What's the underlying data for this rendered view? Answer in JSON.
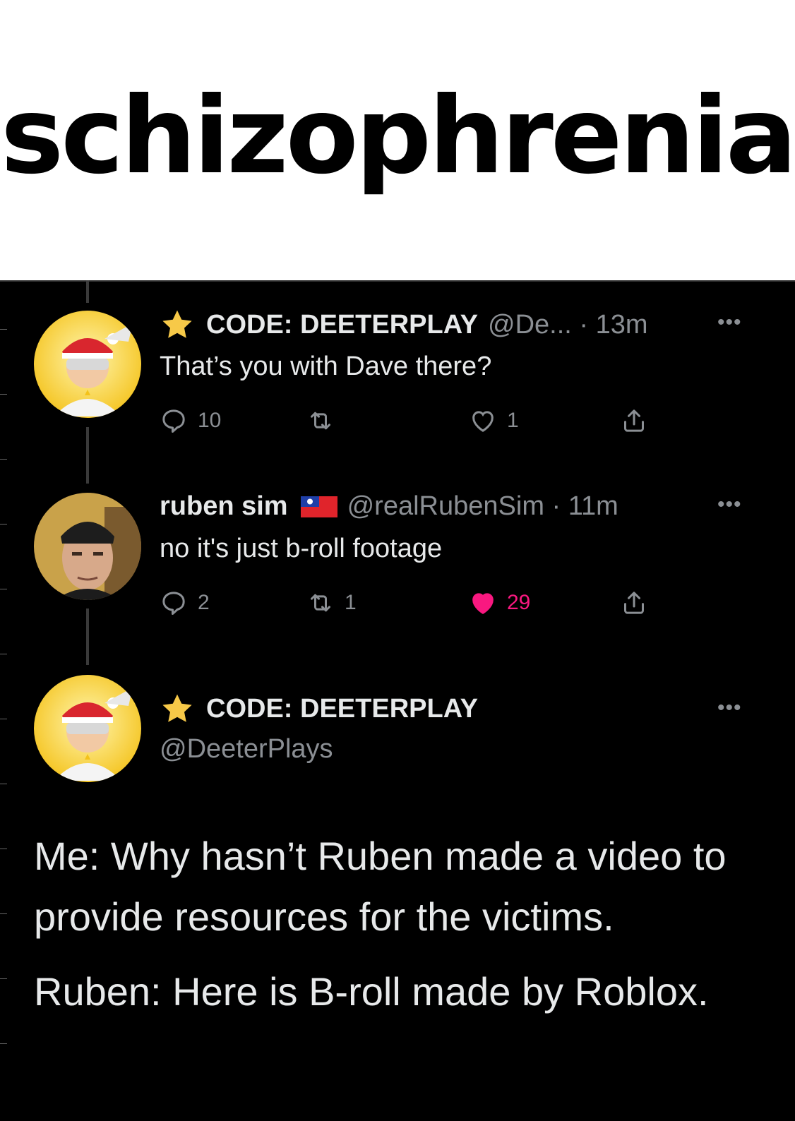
{
  "caption": {
    "text": "schizophrenia"
  },
  "tweets": [
    {
      "display_name": "CODE: DEETERPLAY",
      "handle_time": "@De... · 13m",
      "text": "That’s you with Dave there?",
      "actions": {
        "replies": "10",
        "retweets": "",
        "likes": "1"
      }
    },
    {
      "display_name": "ruben sim",
      "handle_time": "@realRubenSim · 11m",
      "text": "no it's just b-roll footage",
      "actions": {
        "replies": "2",
        "retweets": "1",
        "likes": "29",
        "liked": true
      }
    }
  ],
  "main_tweet": {
    "display_name": "CODE: DEETERPLAY",
    "handle": "@DeeterPlays",
    "paragraph_1": "Me: Why hasn’t Ruben made a video to provide resources for the victims.",
    "paragraph_2": "Ruben: Here is B-roll made by Roblox."
  },
  "colors": {
    "background": "#000000",
    "text": "#e7e9ea",
    "muted": "#8b8f94",
    "like": "#f91880"
  },
  "icons": [
    "star-icon",
    "taiwan-flag-icon",
    "reply-icon",
    "retweet-icon",
    "like-icon",
    "share-icon",
    "more-icon"
  ]
}
